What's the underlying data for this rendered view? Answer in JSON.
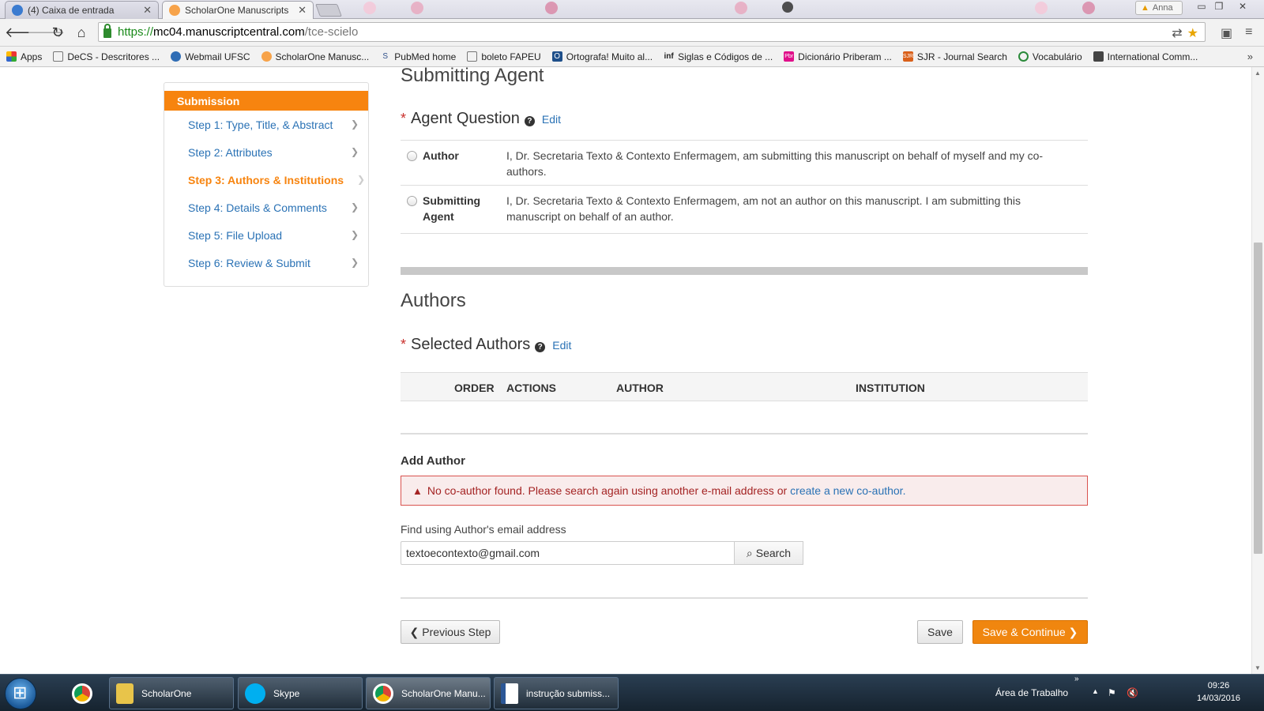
{
  "browser": {
    "tabs": [
      {
        "title": "(4) Caixa de entrada",
        "active": false
      },
      {
        "title": "ScholarOne Manuscripts",
        "active": true
      }
    ],
    "profile_name": "Anna",
    "url": {
      "scheme": "https://",
      "host": "mc04.manuscriptcentral.com",
      "path": "/tce-scielo"
    },
    "bookmarks": [
      "Apps",
      "DeCS - Descritores ...",
      "Webmail UFSC",
      "ScholarOne Manusc...",
      "PubMed home",
      "boleto FAPEU",
      "Ortografa! Muito al...",
      "Siglas e Códigos de ...",
      "Dicionário Priberam ...",
      "SJR - Journal Search",
      "Vocabulário",
      "International Comm..."
    ]
  },
  "sidebar": {
    "header": "Submission",
    "steps": [
      {
        "label": "Step 1: Type, Title, & Abstract",
        "active": false
      },
      {
        "label": "Step 2: Attributes",
        "active": false
      },
      {
        "label": "Step 3: Authors & Institutions",
        "active": true
      },
      {
        "label": "Step 4: Details & Comments",
        "active": false
      },
      {
        "label": "Step 5: File Upload",
        "active": false
      },
      {
        "label": "Step 6: Review & Submit",
        "active": false
      }
    ]
  },
  "submitting_agent": {
    "title": "Submitting Agent",
    "question_label": "Agent Question",
    "edit_label": "Edit",
    "options": [
      {
        "label": "Author",
        "description": "I, Dr. Secretaria Texto & Contexto Enfermagem, am submitting this manuscript on behalf of myself and my co-authors."
      },
      {
        "label": "Submitting Agent",
        "description": "I, Dr. Secretaria Texto & Contexto Enfermagem, am not an author on this manuscript. I am submitting this manuscript on behalf of an author."
      }
    ]
  },
  "authors": {
    "title": "Authors",
    "selected_label": "Selected Authors",
    "edit_label": "Edit",
    "columns": [
      "ORDER",
      "ACTIONS",
      "AUTHOR",
      "INSTITUTION"
    ],
    "add_author_title": "Add Author",
    "alert_text": "No co-author found. Please search again using another e-mail address or",
    "alert_link": "create a new co-author.",
    "find_label": "Find using Author's email address",
    "email_value": "textoecontexto@gmail.com",
    "search_label": "Search"
  },
  "footer_buttons": {
    "previous": "Previous Step",
    "save": "Save",
    "save_continue": "Save & Continue"
  },
  "taskbar": {
    "items": [
      "ScholarOne",
      "Skype",
      "ScholarOne Manu...",
      "instrução submiss..."
    ],
    "desktop_label": "Área de Trabalho",
    "time": "09:26",
    "date": "14/03/2016"
  },
  "colors": {
    "accent": "#f7840f",
    "link": "#2a72b5",
    "alert_border": "#d9534f",
    "alert_bg": "#f9ecec"
  }
}
